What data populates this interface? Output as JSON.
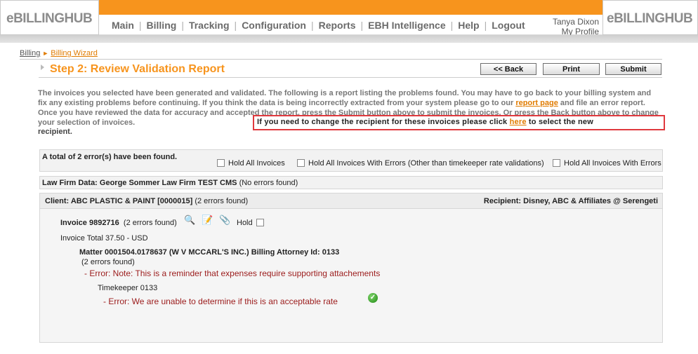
{
  "header": {
    "logo_left": "eBILLINGHUB",
    "logo_right": "eBILLINGHUB",
    "nav": [
      "Main",
      "Billing",
      "Tracking",
      "Configuration",
      "Reports",
      "EBH Intelligence",
      "Help",
      "Logout"
    ],
    "user_name": "Tanya Dixon",
    "profile_link": "My Profile"
  },
  "breadcrumb": {
    "item1": "Billing",
    "item2": "Billing Wizard"
  },
  "step": {
    "title": "Step 2: Review Validation Report",
    "back_label": "<< Back",
    "print_label": "Print",
    "submit_label": "Submit"
  },
  "intro": {
    "part1": "The invoices you selected have been generated and validated. The following is a report listing the problems found. You may have to go back to your billing system and fix any existing problems before continuing. If you think the data is being incorrectly extracted from your system please go to our ",
    "report_link": "report page",
    "part2": " and file an error report. Once you have reviewed the data for accuracy and accepted the report, press the Submit button above to submit the invoices. Or press the Back button above to change your selection of invoices.",
    "highlight_pre": "If you need to change the recipient for these invoices please click ",
    "highlight_link": "here",
    "highlight_post": " to select the new",
    "highlight_tail": "recipient."
  },
  "summary": {
    "total_errors": "A total of 2 error(s) have been found.",
    "hold_all": "Hold All Invoices",
    "hold_errors_other": "Hold All Invoices With Errors (Other than timekeeper rate validations)",
    "hold_errors": "Hold All Invoices With Errors"
  },
  "firm": {
    "label": "Law Firm Data: George Sommer Law Firm TEST CMS",
    "status": "(No errors found)"
  },
  "client": {
    "label": "Client: ABC PLASTIC & PAINT [0000015]",
    "count": "(2 errors found)",
    "recipient": "Recipient: Disney, ABC & Affiliates @ Serengeti"
  },
  "invoice": {
    "label": "Invoice 9892716",
    "count": "(2 errors found)",
    "hold_label": "Hold",
    "total": "Invoice Total 37.50 - USD"
  },
  "matter": {
    "label": "Matter 0001504.0178637 (W V MCCARL'S INC.) Billing Attorney Id: 0133",
    "count": "(2 errors found)",
    "error1": "- Error: Note: This is a reminder that expenses require supporting attachements",
    "timekeeper": "Timekeeper 0133",
    "error2": "- Error: We are unable to determine if this is an acceptable rate",
    "ok_glyph": "✓"
  },
  "icons": {
    "search_glyph": "🔍",
    "edit_glyph": "📝",
    "attach_glyph": "📎"
  },
  "colors": {
    "accent": "#f7941d",
    "error": "#9b1b1b",
    "highlight_border": "#e0393e"
  }
}
